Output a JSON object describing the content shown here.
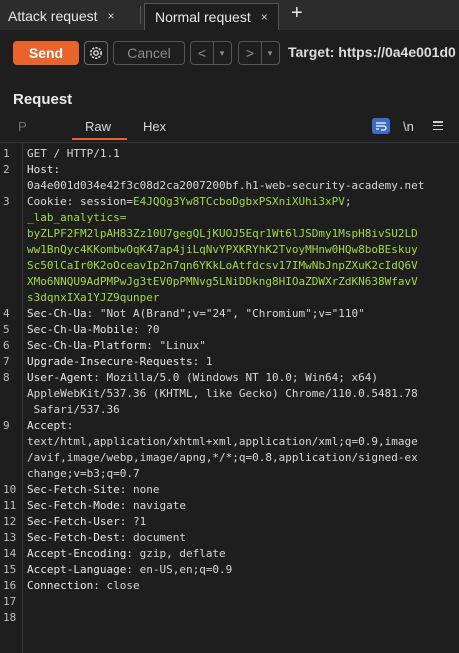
{
  "tabs": [
    {
      "label": "Attack request",
      "close": "×"
    },
    {
      "label": "Normal request",
      "close": "×"
    }
  ],
  "new_tab_glyph": "+",
  "toolbar": {
    "send_label": "Send",
    "cancel_label": "Cancel",
    "back_glyph": "<",
    "forward_glyph": ">",
    "dropdown_glyph": "▾",
    "target_text": "Target: https://0a4e001d0"
  },
  "pane": {
    "title": "Request",
    "tabs": {
      "pretty": "P",
      "raw": "Raw",
      "hex": "Hex"
    },
    "newline_toggle": "\\n"
  },
  "lines": [
    {
      "n": "1",
      "segs": [
        {
          "t": "GET / HTTP/1.1",
          "c": "hv"
        }
      ]
    },
    {
      "n": "2",
      "segs": [
        {
          "t": "Host:",
          "c": "hk"
        }
      ]
    },
    {
      "n": "",
      "segs": [
        {
          "t": "0a4e001d034e42f3c08d2ca2007200bf.h1-web-security-academy.net",
          "c": "hv"
        }
      ]
    },
    {
      "n": "3",
      "segs": [
        {
          "t": "Cookie: session=",
          "c": "ck"
        },
        {
          "t": "E4JQQg3Yw8TCcboDgbxPSXniXUhi3xPV",
          "c": "cv"
        },
        {
          "t": ";",
          "c": "ck"
        }
      ]
    },
    {
      "n": "",
      "segs": [
        {
          "t": "_lab_analytics=",
          "c": "cv"
        }
      ]
    },
    {
      "n": "",
      "segs": [
        {
          "t": "byZLPF2FM2lpAH83Zz10U7gegQLjKUOJ5Eqr1Wt6lJSDmy1MspH8ivSU2LD",
          "c": "cv"
        }
      ]
    },
    {
      "n": "",
      "segs": [
        {
          "t": "ww1BnQyc4KKombwOqK47ap4jiLqNvYPXKRYhK2TvoyMHnw0HQw8boBEskuy",
          "c": "cv"
        }
      ]
    },
    {
      "n": "",
      "segs": [
        {
          "t": "Sc50lCaIr0K2oOceavIp2n7qn6YKkLoAtfdcsv17IMwNbJnpZXuK2cIdQ6V",
          "c": "cv"
        }
      ]
    },
    {
      "n": "",
      "segs": [
        {
          "t": "XMo6NNQU9AdPMPwJg3tEV0pPMNvg5LNiDDkng8HIOaZDWXrZdKN638WfavV",
          "c": "cv"
        }
      ]
    },
    {
      "n": "",
      "segs": [
        {
          "t": "s3dqnxIXa1YJZ9qunper",
          "c": "cv"
        }
      ]
    },
    {
      "n": "4",
      "segs": [
        {
          "t": "Sec-Ch-Ua",
          "c": "hk"
        },
        {
          "t": ": \"Not A(Brand\";v=\"24\", \"Chromium\";v=\"110\"",
          "c": "hv"
        }
      ]
    },
    {
      "n": "5",
      "segs": [
        {
          "t": "Sec-Ch-Ua-Mobile",
          "c": "hk"
        },
        {
          "t": ": ?0",
          "c": "hv"
        }
      ]
    },
    {
      "n": "6",
      "segs": [
        {
          "t": "Sec-Ch-Ua-Platform",
          "c": "hk"
        },
        {
          "t": ": \"Linux\"",
          "c": "hv"
        }
      ]
    },
    {
      "n": "7",
      "segs": [
        {
          "t": "Upgrade-Insecure-Requests",
          "c": "hk"
        },
        {
          "t": ": 1",
          "c": "hv"
        }
      ]
    },
    {
      "n": "8",
      "segs": [
        {
          "t": "User-Agent",
          "c": "hk"
        },
        {
          "t": ": Mozilla/5.0 (Windows NT 10.0; Win64; x64)",
          "c": "hv"
        }
      ]
    },
    {
      "n": "",
      "segs": [
        {
          "t": "AppleWebKit/537.36 (KHTML, like Gecko) Chrome/110.0.5481.78",
          "c": "hv"
        }
      ]
    },
    {
      "n": "",
      "segs": [
        {
          "t": " Safari/537.36",
          "c": "hv"
        }
      ]
    },
    {
      "n": "9",
      "segs": [
        {
          "t": "Accept",
          "c": "hk"
        },
        {
          "t": ":",
          "c": "hv"
        }
      ]
    },
    {
      "n": "",
      "segs": [
        {
          "t": "text/html,application/xhtml+xml,application/xml;q=0.9,image",
          "c": "hv"
        }
      ]
    },
    {
      "n": "",
      "segs": [
        {
          "t": "/avif,image/webp,image/apng,*/*;q=0.8,application/signed-ex",
          "c": "hv"
        }
      ]
    },
    {
      "n": "",
      "segs": [
        {
          "t": "change;v=b3;q=0.7",
          "c": "hv"
        }
      ]
    },
    {
      "n": "10",
      "segs": [
        {
          "t": "Sec-Fetch-Site",
          "c": "hk"
        },
        {
          "t": ": none",
          "c": "hv"
        }
      ]
    },
    {
      "n": "11",
      "segs": [
        {
          "t": "Sec-Fetch-Mode",
          "c": "hk"
        },
        {
          "t": ": navigate",
          "c": "hv"
        }
      ]
    },
    {
      "n": "12",
      "segs": [
        {
          "t": "Sec-Fetch-User",
          "c": "hk"
        },
        {
          "t": ": ?1",
          "c": "hv"
        }
      ]
    },
    {
      "n": "13",
      "segs": [
        {
          "t": "Sec-Fetch-Dest",
          "c": "hk"
        },
        {
          "t": ": document",
          "c": "hv"
        }
      ]
    },
    {
      "n": "14",
      "segs": [
        {
          "t": "Accept-Encoding",
          "c": "hk"
        },
        {
          "t": ": gzip, deflate",
          "c": "hv"
        }
      ]
    },
    {
      "n": "15",
      "segs": [
        {
          "t": "Accept-Language",
          "c": "hk"
        },
        {
          "t": ": en-US,en;q=0.9",
          "c": "hv"
        }
      ]
    },
    {
      "n": "16",
      "segs": [
        {
          "t": "Connection",
          "c": "hk"
        },
        {
          "t": ": close",
          "c": "hv"
        }
      ]
    },
    {
      "n": "17",
      "segs": []
    },
    {
      "n": "18",
      "segs": []
    }
  ],
  "colors": {
    "accent": "#e8642c",
    "cookie_value": "#a3d94a",
    "wrap_icon": "#3d6cc7"
  }
}
